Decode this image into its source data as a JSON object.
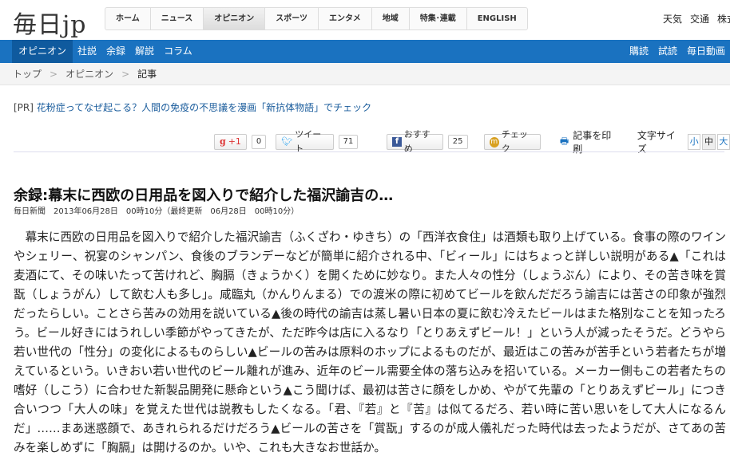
{
  "header": {
    "logo": "毎日jp",
    "nav": [
      "ホーム",
      "ニュース",
      "オピニオン",
      "スポーツ",
      "エンタメ",
      "地域",
      "特集･連載",
      "ENGLISH"
    ],
    "active_nav": "オピニオン",
    "utility": [
      "天気",
      "交通",
      "株式"
    ]
  },
  "subnav": {
    "items": [
      "オピニオン",
      "社説",
      "余録",
      "解説",
      "コラム"
    ],
    "right": [
      "購読",
      "試読",
      "毎日動画"
    ]
  },
  "breadcrumb": [
    "トップ",
    "オピニオン",
    "記事"
  ],
  "breadcrumb_sep": ">",
  "pr": {
    "tag": "[PR]",
    "text": "花粉症ってなぜ起こる？人間の免疫の不思議を漫画「新抗体物語」でチェック"
  },
  "share": {
    "gplus": "+1",
    "gplus_count": "0",
    "tweet": "ツイート",
    "tweet_count": "71",
    "fb": "おすすめ",
    "fb_count": "25",
    "mixi": "チェック",
    "print": "記事を印刷",
    "font_size_label": "文字サイズ",
    "sizes": [
      "小",
      "中",
      "大"
    ]
  },
  "article": {
    "title": "余録:幕末に西欧の日用品を図入りで紹介した福沢諭吉の…",
    "meta": "毎日新聞　2013年06月28日　00時10分（最終更新　06月28日　00時10分）",
    "body": "　幕末に西欧の日用品を図入りで紹介した福沢諭吉（ふくざわ・ゆきち）の「西洋衣食住」は酒類も取り上げている。食事の際のワインやシェリー、祝宴のシャンパン、食後のブランデーなどが簡単に紹介される中、「ビィール」にはちょっと詳しい説明がある▲「これは麦酒にて、その味いたって苦けれど、胸膈（きょうかく）を開くために妙なり。また人々の性分（しょうぶん）により、その苦き味を賞翫（しょうがん）して飲む人も多し」。咸臨丸（かんりんまる）での渡米の際に初めてビールを飲んだだろう諭吉には苦さの印象が強烈だったらしい。ことさら苦みの効用を説いている▲後の時代の諭吉は蒸し暑い日本の夏に飲む冷えたビールはまた格別なことを知ったろう。ビール好きにはうれしい季節がやってきたが、ただ昨今は店に入るなり「とりあえずビール！」という人が減ったそうだ。どうやら若い世代の「性分」の変化によるものらしい▲ビールの苦みは原料のホップによるものだが、最近はこの苦みが苦手という若者たちが増えているという。いきおい若い世代のビール離れが進み、近年のビール需要全体の落ち込みを招いている。メーカー側もこの若者たちの嗜好（しこう）に合わせた新製品開発に懸命という▲こう聞けば、最初は苦さに顔をしかめ、やがて先輩の「とりあえずビール」につき合いつつ「大人の味」を覚えた世代は説教もしたくなる。「君、『若』と『苦』は似てるだろ、若い時に苦い思いをして大人になるんだ」……まあ迷惑顔で、あきれられるだけだろう▲ビールの苦さを「賞翫」するのが成人儀礼だった時代は去ったようだが、さてあの苦みを楽しめずに「胸膈」は開けるのか。いや、これも大きなお世話か。"
  }
}
